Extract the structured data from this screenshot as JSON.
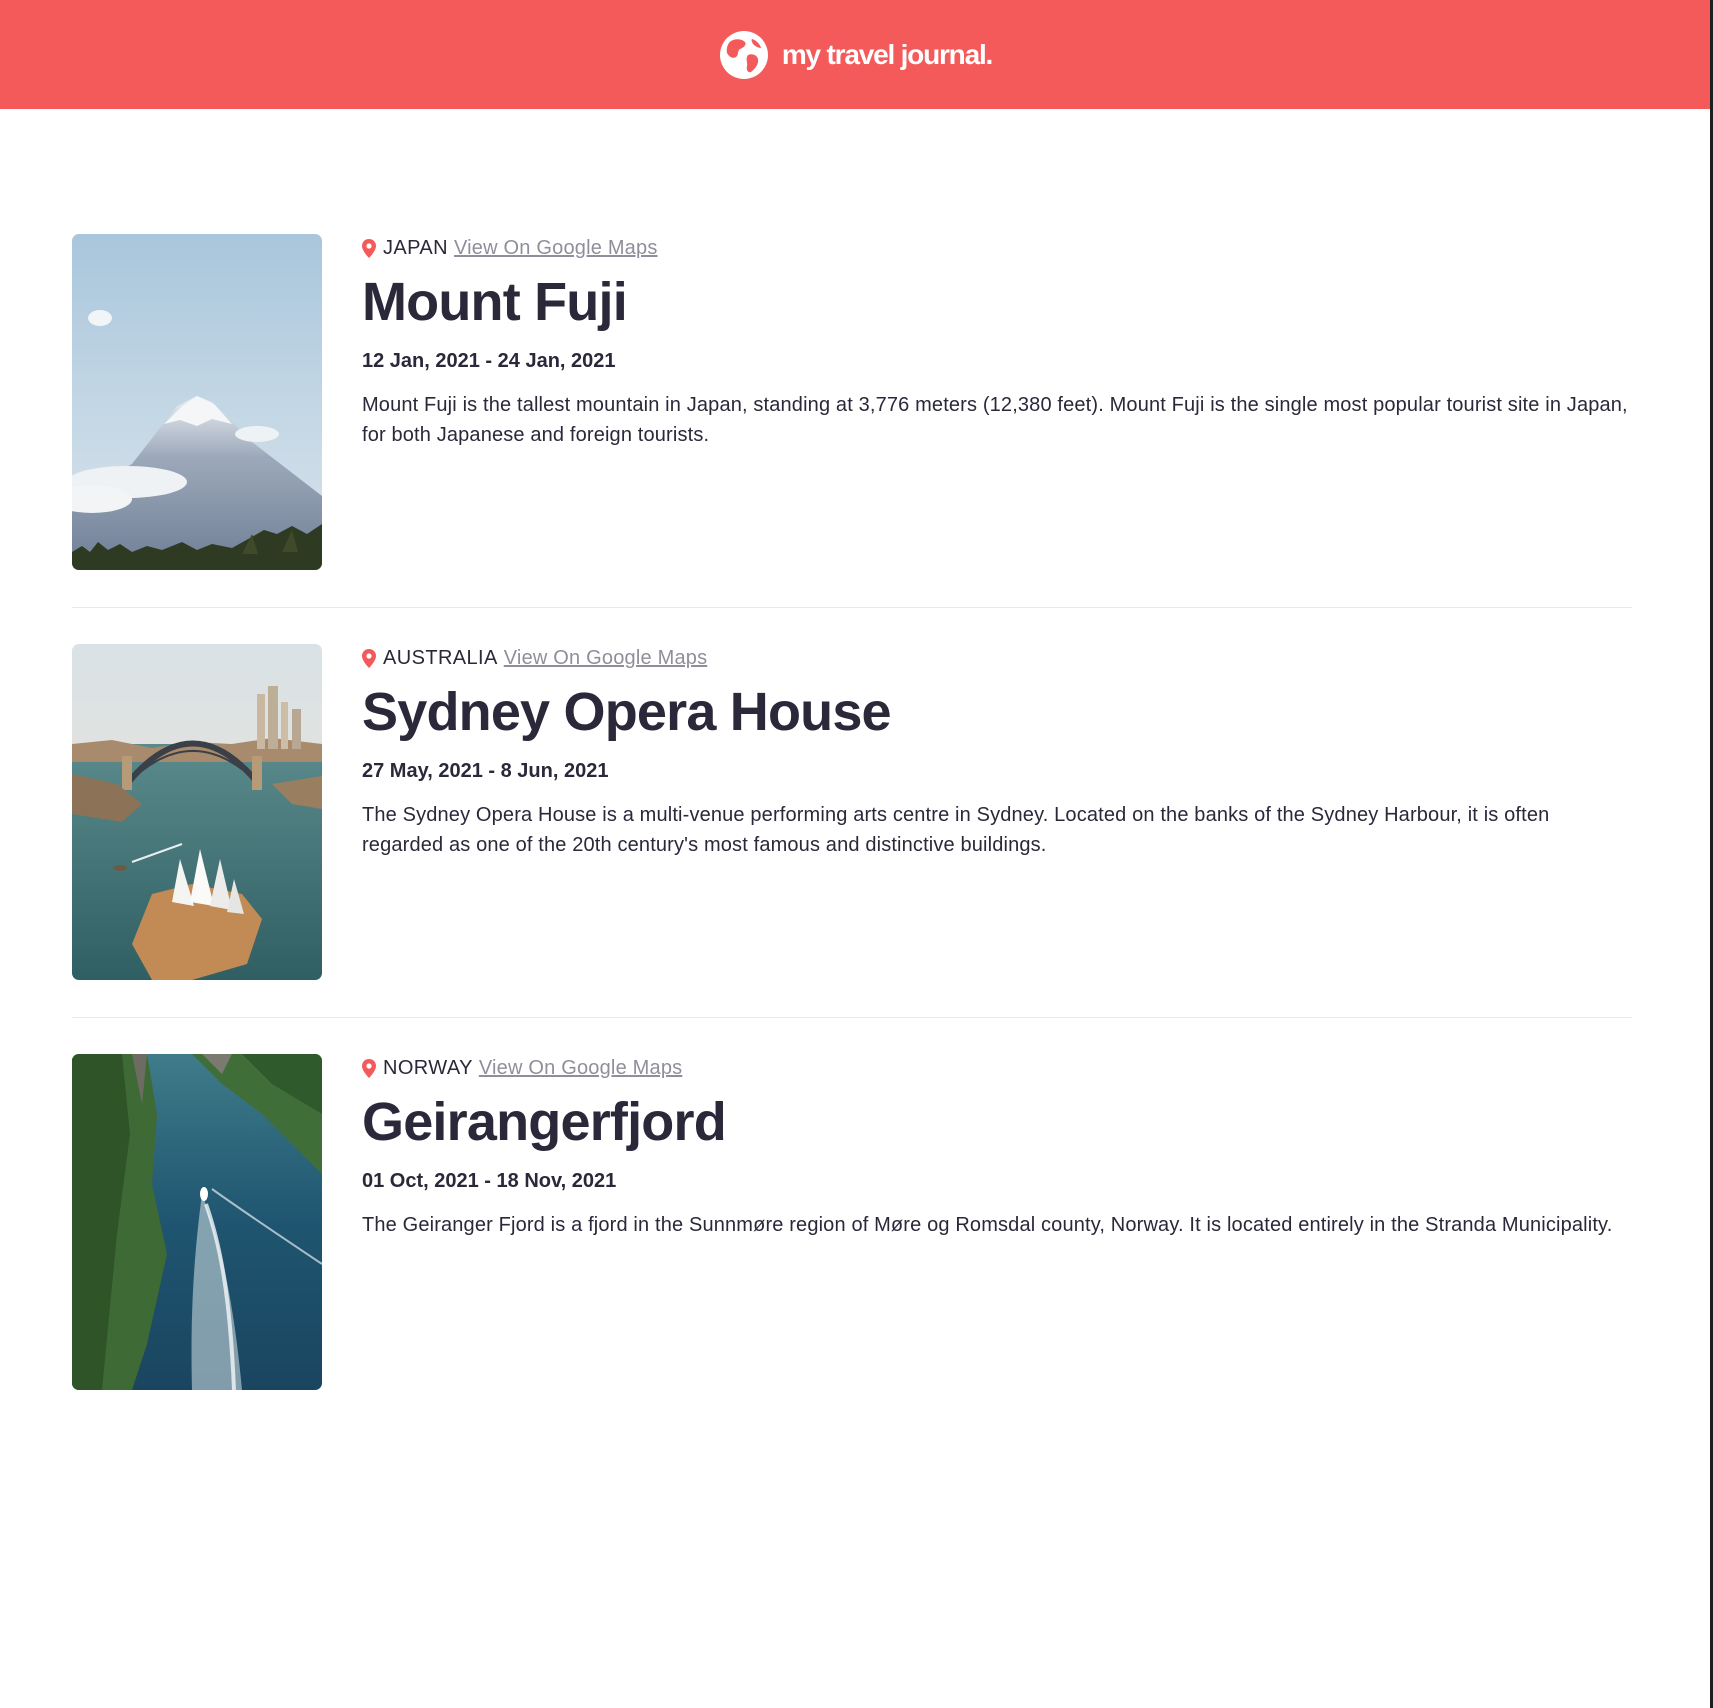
{
  "header": {
    "brand": "my travel journal.",
    "icon": "globe-icon",
    "color": "#F55A5A"
  },
  "entries": [
    {
      "country": "JAPAN",
      "maps_label": "View On Google Maps",
      "title": "Mount Fuji",
      "dates": "12 Jan, 2021 - 24 Jan, 2021",
      "description": "Mount Fuji is the tallest mountain in Japan, standing at 3,776 meters (12,380 feet). Mount Fuji is the single most popular tourist site in Japan, for both Japanese and foreign tourists.",
      "image": "mount-fuji-photo"
    },
    {
      "country": "AUSTRALIA",
      "maps_label": "View On Google Maps",
      "title": "Sydney Opera House",
      "dates": "27 May, 2021 - 8 Jun, 2021",
      "description": "The Sydney Opera House is a multi-venue performing arts centre in Sydney. Located on the banks of the Sydney Harbour, it is often regarded as one of the 20th century's most famous and distinctive buildings.",
      "image": "sydney-opera-house-photo"
    },
    {
      "country": "NORWAY",
      "maps_label": "View On Google Maps",
      "title": "Geirangerfjord",
      "dates": "01 Oct, 2021 - 18 Nov, 2021",
      "description": "The Geiranger Fjord is a fjord in the Sunnmøre region of Møre og Romsdal county, Norway. It is located entirely in the Stranda Municipality.",
      "image": "geirangerfjord-photo"
    }
  ],
  "colors": {
    "accent": "#F55A5A",
    "text": "#2B283A",
    "link": "#918E9B",
    "divider": "#E9E9E9"
  }
}
